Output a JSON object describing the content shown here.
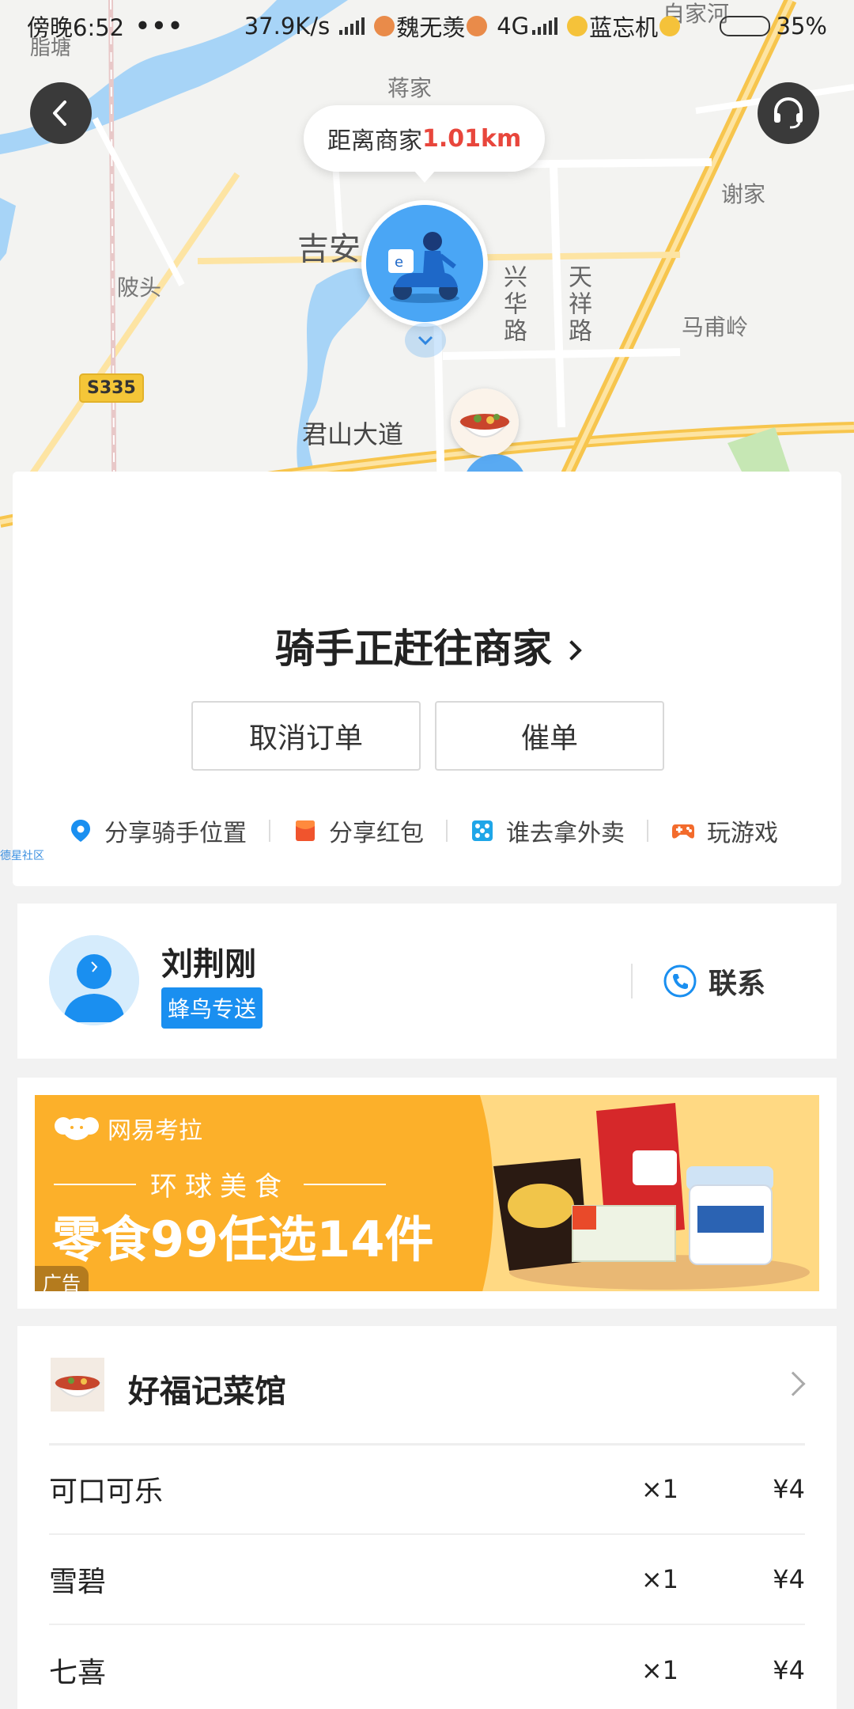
{
  "status_bar": {
    "time": "傍晚6:52",
    "dots": "•••",
    "speed": "37.9K/s",
    "carrier1": "魏无羡",
    "network1": "4G",
    "carrier2": "蓝忘机",
    "battery_percent": 35,
    "battery_label": "35%"
  },
  "map": {
    "labels": {
      "top_village": "蒋家",
      "top_right_village": "自家河",
      "right_village": "谢家",
      "left_village": "陂头",
      "top_left": "脂塘",
      "right_mid": "马甫岭",
      "city": "吉安",
      "road_xinghua": "兴华路",
      "road_tianxiang": "天祥路",
      "road_junshan": "君山大道",
      "highway": "S335",
      "tiny_community": "德星社区"
    },
    "distance_prefix": "距离商家",
    "distance_value": "1.01km"
  },
  "status_card": {
    "title": "骑手正赶往商家",
    "cancel_label": "取消订单",
    "urge_label": "催单",
    "actions": [
      {
        "label": "分享骑手位置",
        "icon": "location-pin-icon"
      },
      {
        "label": "分享红包",
        "icon": "red-envelope-icon"
      },
      {
        "label": "谁去拿外卖",
        "icon": "dice-icon"
      },
      {
        "label": "玩游戏",
        "icon": "gamepad-icon"
      }
    ]
  },
  "rider": {
    "name": "刘荆刚",
    "badge": "蜂鸟专送",
    "contact_label": "联系"
  },
  "ad": {
    "brand": "网易考拉",
    "subtitle": "环球美食",
    "headline": "零食99任选14件",
    "tag": "广告"
  },
  "order": {
    "shop_name": "好福记菜馆",
    "items": [
      {
        "name": "可口可乐",
        "qty": "×1",
        "price": "¥4"
      },
      {
        "name": "雪碧",
        "qty": "×1",
        "price": "¥4"
      },
      {
        "name": "七喜",
        "qty": "×1",
        "price": "¥4"
      }
    ]
  },
  "colors": {
    "accent_blue": "#1a8ff0",
    "distance_red": "#e8463c",
    "ad_orange": "#fcb02a"
  }
}
